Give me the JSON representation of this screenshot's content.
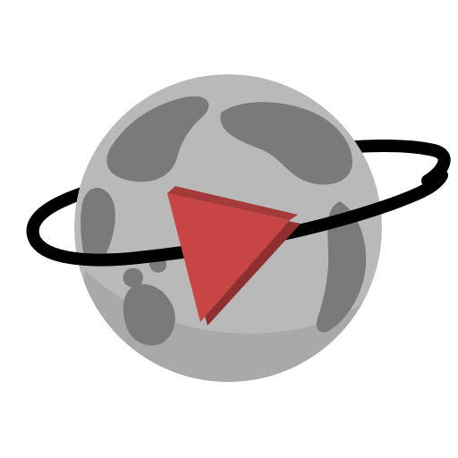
{
  "logo": {
    "icon": "globe-play-icon",
    "colors": {
      "background": "#ffffff",
      "globe_ocean": "#b9b9b9",
      "globe_land": "#7a7a7a",
      "globe_shadow": "#9d9d9d",
      "orbit_ring": "#000000",
      "play_face": "#c84545",
      "play_edge": "#8f2f2f"
    }
  }
}
